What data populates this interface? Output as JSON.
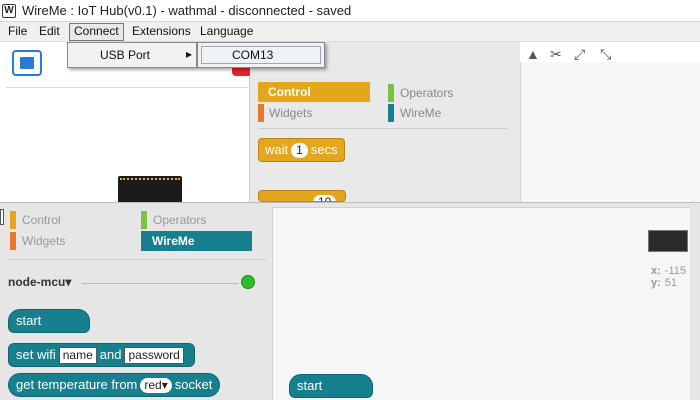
{
  "title_bar": {
    "app_icon": "W",
    "title": "WireMe : IoT Hub(v0.1) - wathmal - disconnected - saved"
  },
  "menu": {
    "items": [
      "File",
      "Edit",
      "Connect",
      "Extensions",
      "Language"
    ],
    "active": "Connect"
  },
  "connect_menu": {
    "usb_port_label": "USB Port",
    "submenu_arrow": "▸",
    "ports": [
      "COM13"
    ]
  },
  "background_window": {
    "categories": {
      "control": "Control",
      "operators": "Operators",
      "widgets": "Widgets",
      "wireme": "WireMe"
    },
    "blocks": {
      "wait_prefix": "wait",
      "wait_value": "1",
      "wait_suffix": "secs",
      "repeat_value": "10"
    },
    "toolbar_icons": [
      "stamp-icon",
      "cut-icon",
      "expand-icon",
      "shrink-icon"
    ]
  },
  "front_window": {
    "categories": {
      "control": "Control",
      "operators": "Operators",
      "widgets": "Widgets",
      "wireme": "WireMe"
    },
    "device": {
      "name": "node-mcu",
      "dropdown_arrow": "▾",
      "status_color": "#2bbd2b"
    },
    "blocks": {
      "start": "start",
      "set_wifi_prefix": "set wifi",
      "wifi_name": "name",
      "set_wifi_and": "and",
      "wifi_password": "password",
      "get_temp_prefix": "get temperature from",
      "socket_value": "red",
      "socket_arrow": "▾",
      "get_temp_suffix": "socket"
    },
    "script": {
      "start_block": "start",
      "x_label": "x:",
      "x_value": "-115",
      "y_label": "y:",
      "y_value": "51"
    }
  },
  "colors": {
    "control": "#e3a61e",
    "operators": "#7bc142",
    "widgets": "#e8782a",
    "wireme": "#16808f",
    "stop": "#e3232d",
    "fullscreen": "#2a7bd8"
  }
}
